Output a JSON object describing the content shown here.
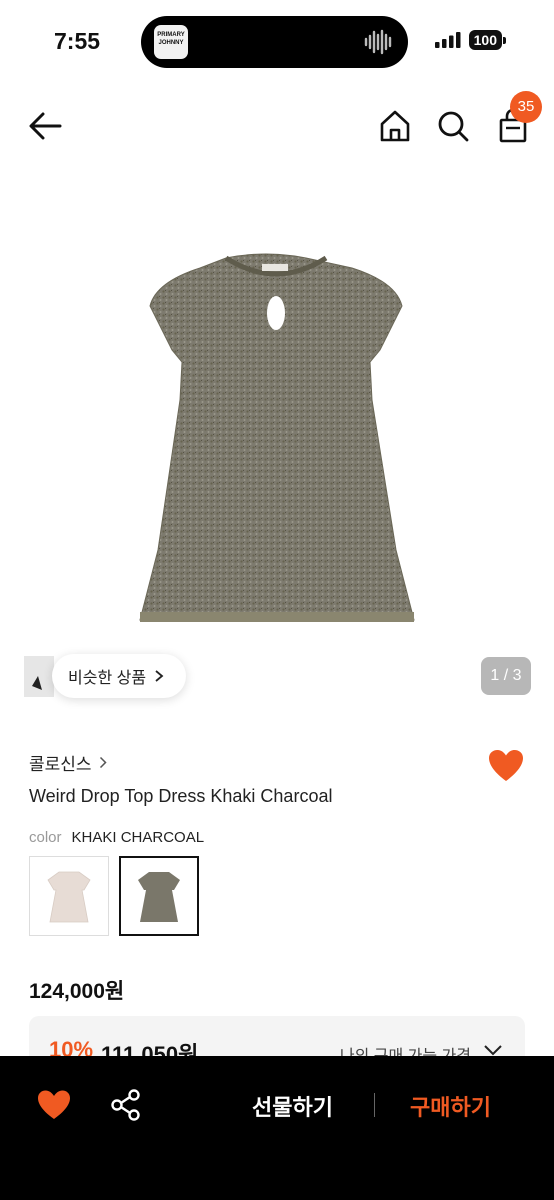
{
  "status_bar": {
    "time": "7:55",
    "battery": "100",
    "island_app_text": [
      "PRIMARY",
      "JOHNNY"
    ]
  },
  "nav": {
    "back_icon": "arrow-left-icon",
    "home_icon": "home-icon",
    "search_icon": "search-icon",
    "bag_icon": "shopping-bag-icon",
    "cart_count": "35"
  },
  "gallery": {
    "similar_label": "비슷한 상품",
    "counter": "1 / 3"
  },
  "product": {
    "brand": "콜로신스",
    "name": "Weird Drop Top Dress Khaki Charcoal",
    "color_label": "color",
    "color_value": "KHAKI CHARCOAL",
    "price": "124,000원",
    "favorited": true
  },
  "discount": {
    "rate": "10%",
    "price": "111,050원",
    "my_price_label": "나의 구매 가능 가격"
  },
  "bottom_bar": {
    "gift_label": "선물하기",
    "buy_label": "구매하기"
  },
  "colors": {
    "accent": "#f05a22",
    "bottom_bar_bg": "#000000"
  }
}
